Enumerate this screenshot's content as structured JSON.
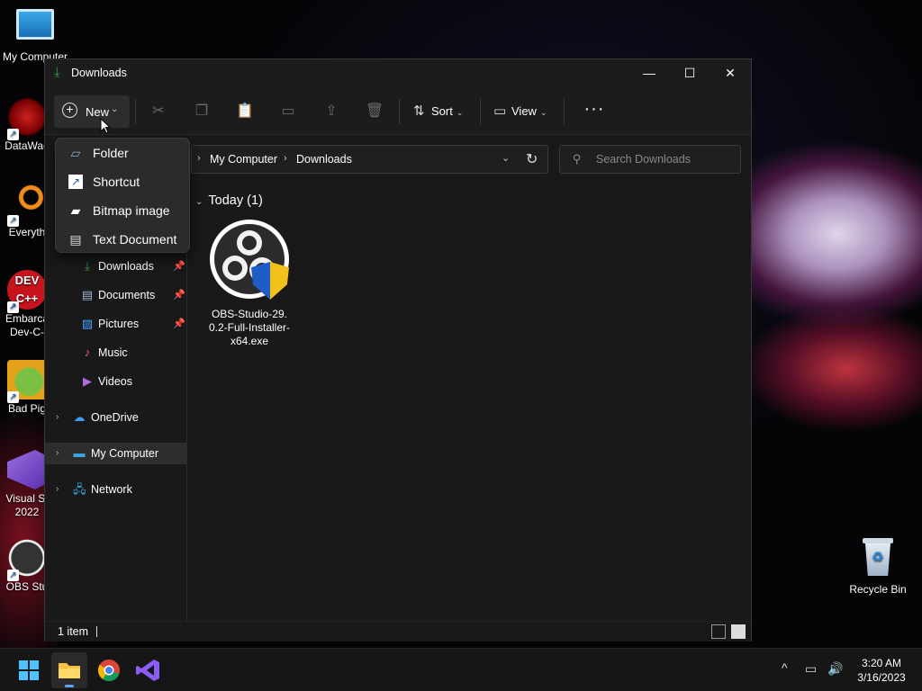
{
  "desktop": {
    "icons": [
      {
        "label": "My Computer"
      },
      {
        "label": "DataWag"
      },
      {
        "label": "Everyth"
      },
      {
        "label": "Embarca",
        "label2": "Dev-C-"
      },
      {
        "label": "Bad Pig"
      },
      {
        "label": "Visual St",
        "label2": "2022"
      },
      {
        "label": "OBS Stu"
      }
    ],
    "recycle_bin": "Recycle Bin"
  },
  "window": {
    "title": "Downloads",
    "controls": {
      "minimize": "—",
      "maximize": "☐",
      "close": "✕"
    }
  },
  "toolbar": {
    "new_label": "New",
    "sort_label": "Sort",
    "view_label": "View",
    "more_label": "···"
  },
  "new_menu": {
    "items": [
      {
        "label": "Folder",
        "icon": "folder-icon"
      },
      {
        "label": "Shortcut",
        "icon": "shortcut-icon"
      },
      {
        "label": "Bitmap image",
        "icon": "bitmap-icon"
      },
      {
        "label": "Text Document",
        "icon": "text-document-icon"
      }
    ]
  },
  "address": {
    "crumbs": [
      "My Computer",
      "Downloads"
    ]
  },
  "search": {
    "placeholder": "Search Downloads"
  },
  "nav": {
    "quick_access": [
      {
        "label": "Downloads",
        "pinned": true
      },
      {
        "label": "Documents",
        "pinned": true
      },
      {
        "label": "Pictures",
        "pinned": true
      },
      {
        "label": "Music",
        "pinned": false
      },
      {
        "label": "Videos",
        "pinned": false
      }
    ],
    "roots": [
      {
        "label": "OneDrive"
      },
      {
        "label": "My Computer",
        "selected": true
      },
      {
        "label": "Network"
      }
    ]
  },
  "content": {
    "group": "Today (1)",
    "files": [
      {
        "name": "OBS-Studio-29.0.2-Full-Installer-x64.exe"
      }
    ]
  },
  "status": {
    "count": "1 item"
  },
  "taskbar": {
    "clock_time": "3:20 AM",
    "clock_date": "3/16/2023"
  },
  "colors": {
    "accent": "#60a5fa",
    "window_bg": "#191919",
    "menu_bg": "#2b2b2b"
  }
}
